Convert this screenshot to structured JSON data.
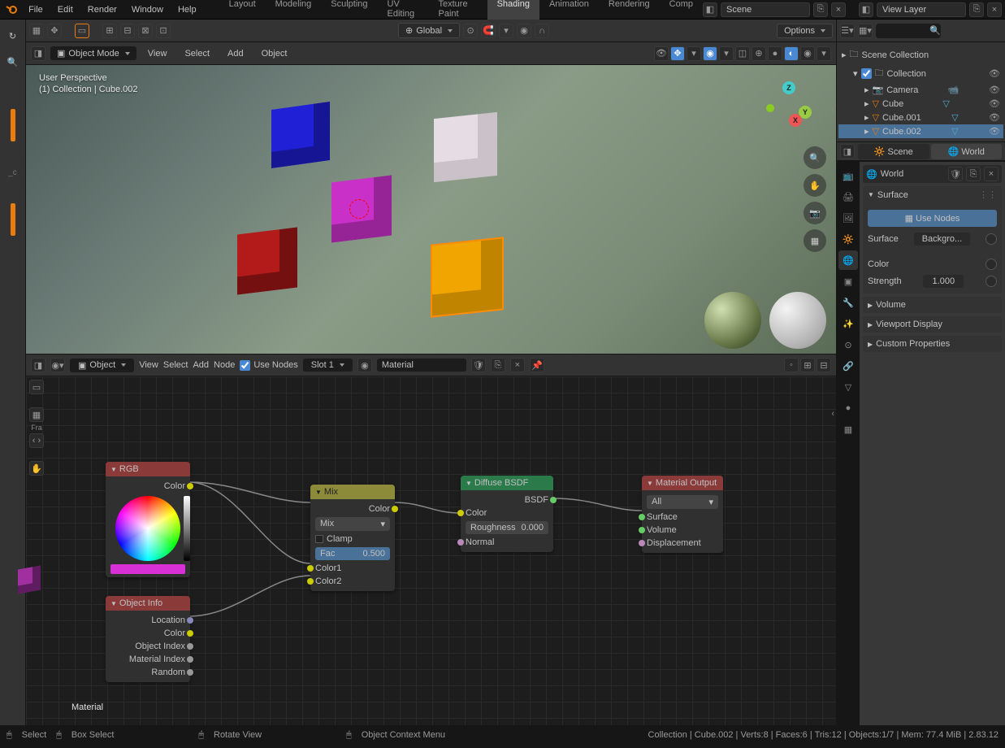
{
  "menus": {
    "file": "File",
    "edit": "Edit",
    "render": "Render",
    "window": "Window",
    "help": "Help"
  },
  "workspaces": [
    "Layout",
    "Modeling",
    "Sculpting",
    "UV Editing",
    "Texture Paint",
    "Shading",
    "Animation",
    "Rendering",
    "Comp"
  ],
  "active_workspace": "Shading",
  "scene_name": "Scene",
  "view_layer": "View Layer",
  "toolbar2": {
    "orientation": "Global",
    "options": "Options"
  },
  "viewport_header": {
    "mode": "Object Mode",
    "view": "View",
    "select": "Select",
    "add": "Add",
    "object": "Object"
  },
  "viewport_info": {
    "line1": "User Perspective",
    "line2": "(1) Collection | Cube.002"
  },
  "outliner": {
    "root": "Scene Collection",
    "coll": "Collection",
    "items": [
      {
        "name": "Camera",
        "type": "camera"
      },
      {
        "name": "Cube",
        "type": "mesh"
      },
      {
        "name": "Cube.001",
        "type": "mesh"
      },
      {
        "name": "Cube.002",
        "type": "mesh",
        "selected": true
      }
    ]
  },
  "node_header": {
    "mode": "Object",
    "view": "View",
    "select": "Select",
    "add": "Add",
    "node": "Node",
    "use_nodes": "Use Nodes",
    "slot": "Slot 1",
    "material": "Material"
  },
  "node_editor_label": "Material",
  "nodes": {
    "rgb": {
      "title": "RGB",
      "out": "Color"
    },
    "objinfo": {
      "title": "Object Info",
      "outs": [
        "Location",
        "Color",
        "Object Index",
        "Material Index",
        "Random"
      ]
    },
    "mix": {
      "title": "Mix",
      "out": "Color",
      "type": "Mix",
      "clamp": "Clamp",
      "fac_label": "Fac",
      "fac": "0.500",
      "in1": "Color1",
      "in2": "Color2"
    },
    "diffuse": {
      "title": "Diffuse BSDF",
      "out": "BSDF",
      "ins": [
        "Color",
        "Roughness",
        "Normal"
      ],
      "roughness": "0.000"
    },
    "output": {
      "title": "Material Output",
      "target": "All",
      "ins": [
        "Surface",
        "Volume",
        "Displacement"
      ]
    }
  },
  "props": {
    "tabs": [
      "Scene",
      "World"
    ],
    "active_tab": "World",
    "world_name": "World",
    "surface_panel": "Surface",
    "use_nodes": "Use Nodes",
    "surface_label": "Surface",
    "surface_value": "Backgro...",
    "color_label": "Color",
    "strength_label": "Strength",
    "strength_value": "1.000",
    "volume": "Volume",
    "viewport": "Viewport Display",
    "custom": "Custom Properties"
  },
  "status": {
    "select": "Select",
    "box": "Box Select",
    "rotate": "Rotate View",
    "menu": "Object Context Menu",
    "stats": "Collection | Cube.002 | Verts:8 | Faces:6 | Tris:12 | Objects:1/7 | Mem: 77.4 MiB | 2.83.12"
  }
}
